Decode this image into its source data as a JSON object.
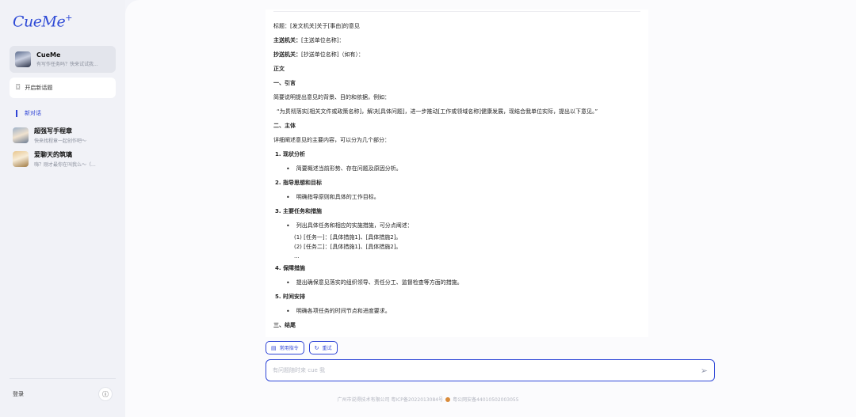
{
  "sidebar": {
    "logo": "CueMe",
    "logo_plus": "+",
    "bot": {
      "title": "CueMe",
      "subtitle": "有写作任务吗？快来试试我..."
    },
    "new_topic": "开启新话题",
    "new_chat": "新对话",
    "conversations": [
      {
        "title": "超强写手程章",
        "subtitle": "快来找程章一起创作吧～"
      },
      {
        "title": "爱聊天的筑璃",
        "subtitle": "嗨？刚才最你在叫我么～（..."
      }
    ],
    "login": "登录",
    "info_icon": "ⓘ"
  },
  "article": {
    "lines": [
      {
        "type": "plain",
        "text": "标题：[发文机关]关于[事由]的意见"
      },
      {
        "type": "label",
        "label": "主送机关：",
        "text": "[主送单位名称]："
      },
      {
        "type": "label",
        "label": "抄送机关：",
        "text": "[抄送单位名称]（如有）："
      },
      {
        "type": "heading",
        "text": "正文"
      },
      {
        "type": "heading",
        "text": "一、引言"
      },
      {
        "type": "plain",
        "text": "简要说明提出意见的背景、目的和依据，例如："
      },
      {
        "type": "quote",
        "text": "“为贯彻落实[相关文件或政策名称]，解决[具体问题]，进一步推动[工作或领域名称]健康发展，现结合我单位实际，提出以下意见。”"
      },
      {
        "type": "heading",
        "text": "二、主体"
      },
      {
        "type": "plain",
        "text": "详细阐述意见的主要内容，可以分为几个部分："
      },
      {
        "type": "num",
        "text": "1. 现状分析"
      },
      {
        "type": "bullet",
        "text": "简要概述当前形势、存在问题及原因分析。"
      },
      {
        "type": "num",
        "text": "2. 指导思想和目标"
      },
      {
        "type": "bullet",
        "text": "明确指导原则和具体的工作目标。"
      },
      {
        "type": "num",
        "text": "3. 主要任务和措施"
      },
      {
        "type": "bullet",
        "text": "列出具体任务和相应的实施措施，可分点阐述："
      },
      {
        "type": "sub",
        "text": "(1) [任务一]：[具体措施1]、[具体措施2]。"
      },
      {
        "type": "sub",
        "text": "(2) [任务二]：[具体措施1]、[具体措施2]。"
      },
      {
        "type": "sub",
        "text": "..."
      },
      {
        "type": "num",
        "text": "4. 保障措施"
      },
      {
        "type": "bullet",
        "text": "提出确保意见落实的组织领导、责任分工、监督检查等方面的措施。"
      },
      {
        "type": "num",
        "text": "5. 时间安排"
      },
      {
        "type": "bullet",
        "text": "明确各项任务的时间节点和进度要求。"
      },
      {
        "type": "heading",
        "text": "三、结尾"
      }
    ]
  },
  "chips": [
    {
      "icon": "▤",
      "label": "常用指令"
    },
    {
      "icon": "↻",
      "label": "重试"
    }
  ],
  "input": {
    "placeholder": "有问题随时来 cue 我",
    "value": ""
  },
  "footer": {
    "left": "广州市说得技术有限公司 粤ICP备2022013084号",
    "right": "粤公网安备44010502003055"
  }
}
